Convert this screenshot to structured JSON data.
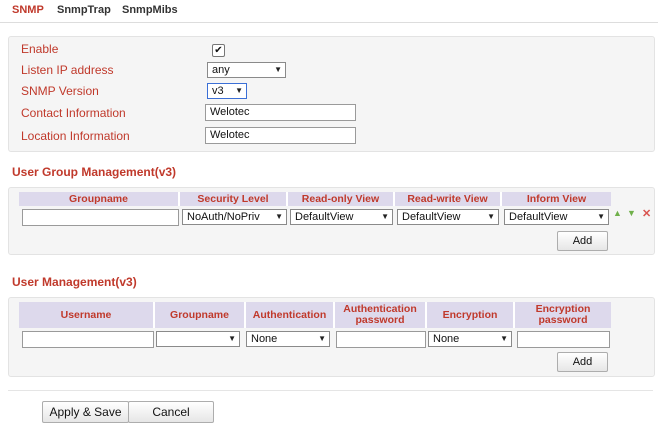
{
  "tabs": [
    "SNMP",
    "SnmpTrap",
    "SnmpMibs"
  ],
  "config": {
    "enable_label": "Enable",
    "enable_checked": true,
    "listen_ip_label": "Listen IP address",
    "listen_ip_value": "any",
    "snmp_version_label": "SNMP Version",
    "snmp_version_value": "v3",
    "contact_label": "Contact Information",
    "contact_value": "Welotec",
    "location_label": "Location Information",
    "location_value": "Welotec"
  },
  "user_group": {
    "title": "User Group Management(v3)",
    "columns": [
      "Groupname",
      "Security Level",
      "Read-only View",
      "Read-write View",
      "Inform View"
    ],
    "row": {
      "groupname": "",
      "security_level": "NoAuth/NoPriv",
      "read_only_view": "DefaultView",
      "read_write_view": "DefaultView",
      "inform_view": "DefaultView"
    },
    "add_label": "Add"
  },
  "user_mgmt": {
    "title": "User Management(v3)",
    "columns": [
      "Username",
      "Groupname",
      "Authentication",
      "Authentication password",
      "Encryption",
      "Encryption password"
    ],
    "row": {
      "username": "",
      "groupname": "",
      "authentication": "None",
      "auth_password": "",
      "encryption": "None",
      "enc_password": ""
    },
    "add_label": "Add"
  },
  "actions": {
    "apply_label": "Apply & Save",
    "cancel_label": "Cancel"
  },
  "icons": {
    "move_up": "arrow-up-icon",
    "move_down": "arrow-down-icon",
    "delete": "delete-icon"
  },
  "colors": {
    "label_red": "#c0392b",
    "header_lavender": "#ddd9ec",
    "panel_bg": "#f5f5f5",
    "icon_green": "#6fb04a",
    "icon_red": "#d9534f"
  }
}
